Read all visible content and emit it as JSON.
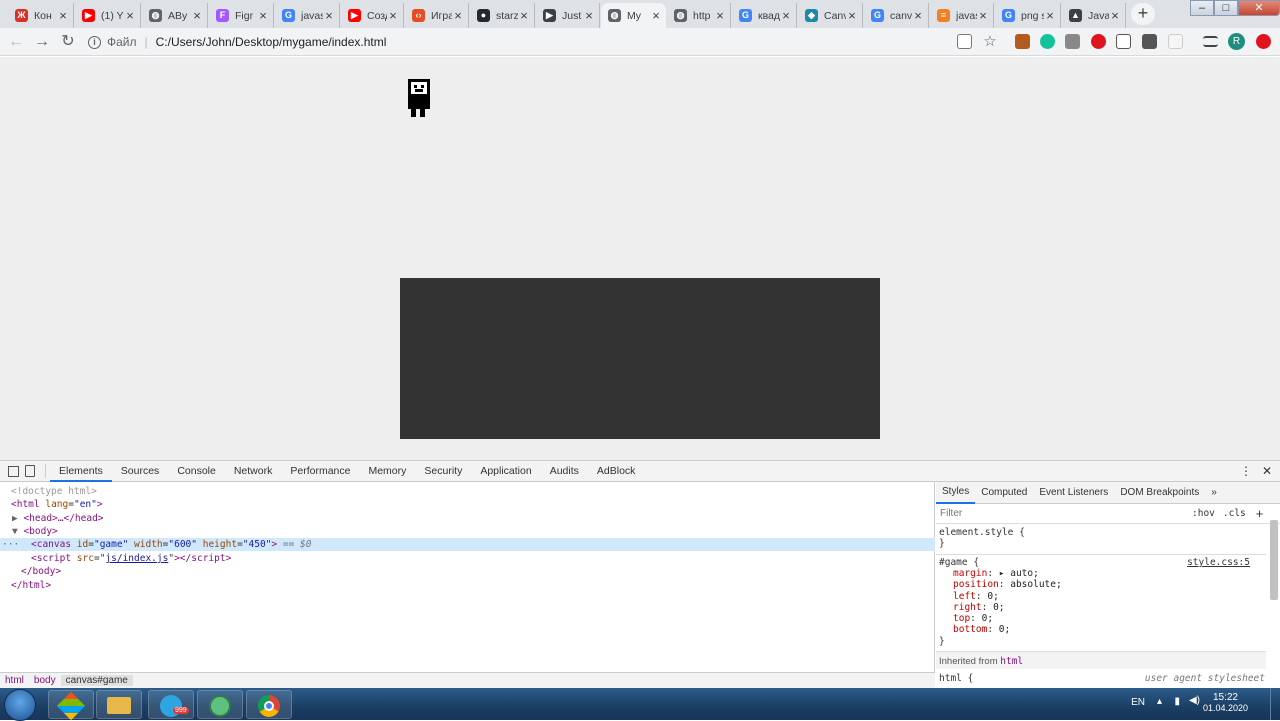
{
  "browser": {
    "tabs": [
      {
        "title": "Кон",
        "icon": "red-x-icon",
        "color": "#d93025",
        "glyph": "Ж"
      },
      {
        "title": "(1) Y",
        "icon": "youtube-icon",
        "color": "#ff0000",
        "glyph": "▶"
      },
      {
        "title": "ABy",
        "icon": "globe-icon",
        "color": "#5f6368",
        "glyph": "◍"
      },
      {
        "title": "Figr",
        "icon": "figma-icon",
        "color": "#a259ff",
        "glyph": "F"
      },
      {
        "title": "javascrip",
        "icon": "google-icon",
        "color": "#4285f4",
        "glyph": "G"
      },
      {
        "title": "Создан",
        "icon": "youtube-icon",
        "color": "#ff0000",
        "glyph": "▶"
      },
      {
        "title": "Игра на",
        "icon": "code-icon",
        "color": "#e44d26",
        "glyph": "‹›"
      },
      {
        "title": "starzone",
        "icon": "github-icon",
        "color": "#24292e",
        "glyph": "●"
      },
      {
        "title": "Just",
        "icon": "play-icon",
        "color": "#3c4043",
        "glyph": "▶"
      },
      {
        "title": "My",
        "icon": "globe-icon",
        "color": "#5f6368",
        "glyph": "◍"
      },
      {
        "title": "http",
        "icon": "globe-icon",
        "color": "#5f6368",
        "glyph": "◍"
      },
      {
        "title": "квадра",
        "icon": "google-icon",
        "color": "#4285f4",
        "glyph": "G"
      },
      {
        "title": "Canvas",
        "icon": "canvas-icon",
        "color": "#1e88a8",
        "glyph": "◆"
      },
      {
        "title": "canvas",
        "icon": "google-icon",
        "color": "#4285f4",
        "glyph": "G"
      },
      {
        "title": "javascri",
        "icon": "stack-overflow-icon",
        "color": "#f48024",
        "glyph": "≡"
      },
      {
        "title": "png sm",
        "icon": "google-icon",
        "color": "#4285f4",
        "glyph": "G"
      },
      {
        "title": "Javascri",
        "icon": "graduation-cap-icon",
        "color": "#3c4043",
        "glyph": "▲"
      }
    ],
    "active_tab_index": 9,
    "address": {
      "file_label": "Файл",
      "url": "C:/Users/John/Desktop/mygame/index.html"
    }
  },
  "page": {
    "background": "#eeeeee",
    "canvas_color": "#333333"
  },
  "devtools": {
    "tabs": [
      "Elements",
      "Sources",
      "Console",
      "Network",
      "Performance",
      "Memory",
      "Security",
      "Application",
      "Audits",
      "AdBlock"
    ],
    "active_tab": "Elements",
    "dom": {
      "doctype": "<!doctype html>",
      "html_open": "html",
      "lang_attr": "lang",
      "lang_val": "\"en\"",
      "head": "<head>…</head>",
      "body_open": "<body>",
      "canvas_tag": "canvas",
      "canvas_attrs": [
        {
          "name": "id",
          "value": "\"game\""
        },
        {
          "name": "width",
          "value": "\"600\""
        },
        {
          "name": "height",
          "value": "\"450\""
        }
      ],
      "canvas_suffix": "== $0",
      "script_tag": "script",
      "script_attr": "src",
      "script_src": "js/index.js",
      "body_close": "</body>",
      "html_close": "</html>"
    },
    "breadcrumbs": [
      "html",
      "body",
      "canvas#game"
    ],
    "styles": {
      "tabs": [
        "Styles",
        "Computed",
        "Event Listeners",
        "DOM Breakpoints",
        "»"
      ],
      "filter_placeholder": "Filter",
      "hov": ":hov",
      "cls": ".cls",
      "add": "+",
      "element_style": "element.style {",
      "close_brace": "}",
      "rule_selector": "#game {",
      "rule_source": "style.css:5",
      "declarations": [
        {
          "prop": "margin",
          "value": "▸ auto;"
        },
        {
          "prop": "position",
          "value": "absolute;"
        },
        {
          "prop": "left",
          "value": "0;"
        },
        {
          "prop": "right",
          "value": "0;"
        },
        {
          "prop": "top",
          "value": "0;"
        },
        {
          "prop": "bottom",
          "value": "0;"
        }
      ],
      "inherited_label": "Inherited from",
      "inherited_from": "html",
      "ua_selector": "html {",
      "ua_source": "user agent stylesheet"
    }
  },
  "taskbar": {
    "apps": [
      "explorer-folder-icon",
      "telegram-icon",
      "atom-icon",
      "chrome-icon"
    ],
    "telegram_badge": "999",
    "lang": "EN",
    "time": "15:22",
    "date": "01.04.2020"
  }
}
